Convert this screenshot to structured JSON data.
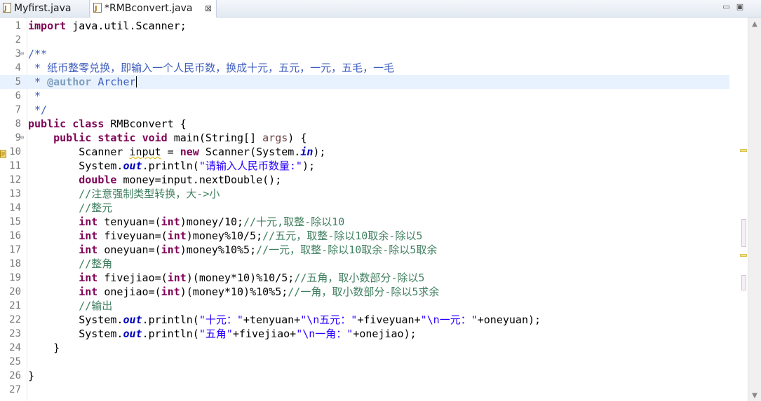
{
  "tabs": [
    {
      "label": "Myfirst.java",
      "icon": "java-file-icon",
      "active": false
    },
    {
      "label": "*RMBconvert.java",
      "icon": "java-file-icon",
      "active": true,
      "close": "⊠"
    }
  ],
  "window_buttons": {
    "minimize": "▭",
    "maximize": "▣"
  },
  "editor": {
    "current_line": 5,
    "lines": [
      {
        "n": "1",
        "tokens": [
          [
            "kw",
            "import"
          ],
          [
            "t",
            " java.util.Scanner;"
          ]
        ]
      },
      {
        "n": "2",
        "tokens": []
      },
      {
        "n": "3",
        "fold": "⊖",
        "tokens": [
          [
            "jd",
            "/**"
          ]
        ]
      },
      {
        "n": "4",
        "tokens": [
          [
            "jd",
            " * 纸币整零兑换，即输入一个人民币数，换成十元，五元，一元，五毛，一毛"
          ]
        ]
      },
      {
        "n": "5",
        "tokens": [
          [
            "jd",
            " * "
          ],
          [
            "jt",
            "@author"
          ],
          [
            "jd",
            " Archer"
          ]
        ],
        "cursor": true
      },
      {
        "n": "6",
        "tokens": [
          [
            "jd",
            " *"
          ]
        ]
      },
      {
        "n": "7",
        "tokens": [
          [
            "jd",
            " */"
          ]
        ]
      },
      {
        "n": "8",
        "tokens": [
          [
            "kw",
            "public"
          ],
          [
            "t",
            " "
          ],
          [
            "kw",
            "class"
          ],
          [
            "t",
            " RMBconvert {"
          ]
        ]
      },
      {
        "n": "9",
        "fold": "⊖",
        "tokens": [
          [
            "t",
            "    "
          ],
          [
            "kw",
            "public"
          ],
          [
            "t",
            " "
          ],
          [
            "kw",
            "static"
          ],
          [
            "t",
            " "
          ],
          [
            "kw",
            "void"
          ],
          [
            "t",
            " main(String[] "
          ],
          [
            "pm",
            "args"
          ],
          [
            "t",
            ") {"
          ]
        ]
      },
      {
        "n": "10",
        "warning": true,
        "tokens": [
          [
            "t",
            "        Scanner "
          ],
          [
            "sq",
            "input"
          ],
          [
            "t",
            " = "
          ],
          [
            "kw",
            "new"
          ],
          [
            "t",
            " Scanner(System."
          ],
          [
            "fd",
            "in"
          ],
          [
            "t",
            ");"
          ]
        ]
      },
      {
        "n": "11",
        "tokens": [
          [
            "t",
            "        System."
          ],
          [
            "fd",
            "out"
          ],
          [
            "t",
            ".println("
          ],
          [
            "st",
            "\"请输入人民币数量:\""
          ],
          [
            "t",
            ");"
          ]
        ]
      },
      {
        "n": "12",
        "tokens": [
          [
            "t",
            "        "
          ],
          [
            "kw",
            "double"
          ],
          [
            "t",
            " money=input.nextDouble();"
          ]
        ]
      },
      {
        "n": "13",
        "tokens": [
          [
            "cm",
            "        //注意强制类型转换，大->小"
          ]
        ]
      },
      {
        "n": "14",
        "tokens": [
          [
            "cm",
            "        //整元"
          ]
        ]
      },
      {
        "n": "15",
        "tokens": [
          [
            "t",
            "        "
          ],
          [
            "kw",
            "int"
          ],
          [
            "t",
            " tenyuan=("
          ],
          [
            "kw",
            "int"
          ],
          [
            "t",
            ")money/10;"
          ],
          [
            "cm",
            "//十元,取整-除以10"
          ]
        ]
      },
      {
        "n": "16",
        "tokens": [
          [
            "t",
            "        "
          ],
          [
            "kw",
            "int"
          ],
          [
            "t",
            " fiveyuan=("
          ],
          [
            "kw",
            "int"
          ],
          [
            "t",
            ")money%10/5;"
          ],
          [
            "cm",
            "//五元，取整-除以10取余-除以5"
          ]
        ]
      },
      {
        "n": "17",
        "tokens": [
          [
            "t",
            "        "
          ],
          [
            "kw",
            "int"
          ],
          [
            "t",
            " oneyuan=("
          ],
          [
            "kw",
            "int"
          ],
          [
            "t",
            ")money%10%5;"
          ],
          [
            "cm",
            "//一元，取整-除以10取余-除以5取余"
          ]
        ]
      },
      {
        "n": "18",
        "tokens": [
          [
            "cm",
            "        //整角"
          ]
        ]
      },
      {
        "n": "19",
        "tokens": [
          [
            "t",
            "        "
          ],
          [
            "kw",
            "int"
          ],
          [
            "t",
            " fivejiao=("
          ],
          [
            "kw",
            "int"
          ],
          [
            "t",
            ")(money*10)%10/5;"
          ],
          [
            "cm",
            "//五角，取小数部分-除以5"
          ]
        ]
      },
      {
        "n": "20",
        "tokens": [
          [
            "t",
            "        "
          ],
          [
            "kw",
            "int"
          ],
          [
            "t",
            " onejiao=("
          ],
          [
            "kw",
            "int"
          ],
          [
            "t",
            ")(money*10)%10%5;"
          ],
          [
            "cm",
            "//一角，取小数部分-除以5求余"
          ]
        ]
      },
      {
        "n": "21",
        "tokens": [
          [
            "cm",
            "        //输出"
          ]
        ]
      },
      {
        "n": "22",
        "tokens": [
          [
            "t",
            "        System."
          ],
          [
            "fd",
            "out"
          ],
          [
            "t",
            ".println("
          ],
          [
            "st",
            "\"十元：\""
          ],
          [
            "t",
            "+tenyuan+"
          ],
          [
            "st",
            "\"\\n五元：\""
          ],
          [
            "t",
            "+fiveyuan+"
          ],
          [
            "st",
            "\"\\n一元：\""
          ],
          [
            "t",
            "+oneyuan);"
          ]
        ]
      },
      {
        "n": "23",
        "tokens": [
          [
            "t",
            "        System."
          ],
          [
            "fd",
            "out"
          ],
          [
            "t",
            ".println("
          ],
          [
            "st",
            "\"五角\""
          ],
          [
            "t",
            "+fivejiao+"
          ],
          [
            "st",
            "\"\\n一角：\""
          ],
          [
            "t",
            "+onejiao);"
          ]
        ]
      },
      {
        "n": "24",
        "tokens": [
          [
            "t",
            "    }"
          ]
        ]
      },
      {
        "n": "25",
        "tokens": []
      },
      {
        "n": "26",
        "tokens": [
          [
            "t",
            "}"
          ]
        ]
      },
      {
        "n": "27",
        "tokens": []
      }
    ]
  },
  "colors": {
    "keyword": "#7f0055",
    "comment": "#3f7f5f",
    "javadoc": "#3f5fbf",
    "string": "#2a00ff",
    "static_field": "#0000c0",
    "current_line": "#e8f2fe"
  }
}
